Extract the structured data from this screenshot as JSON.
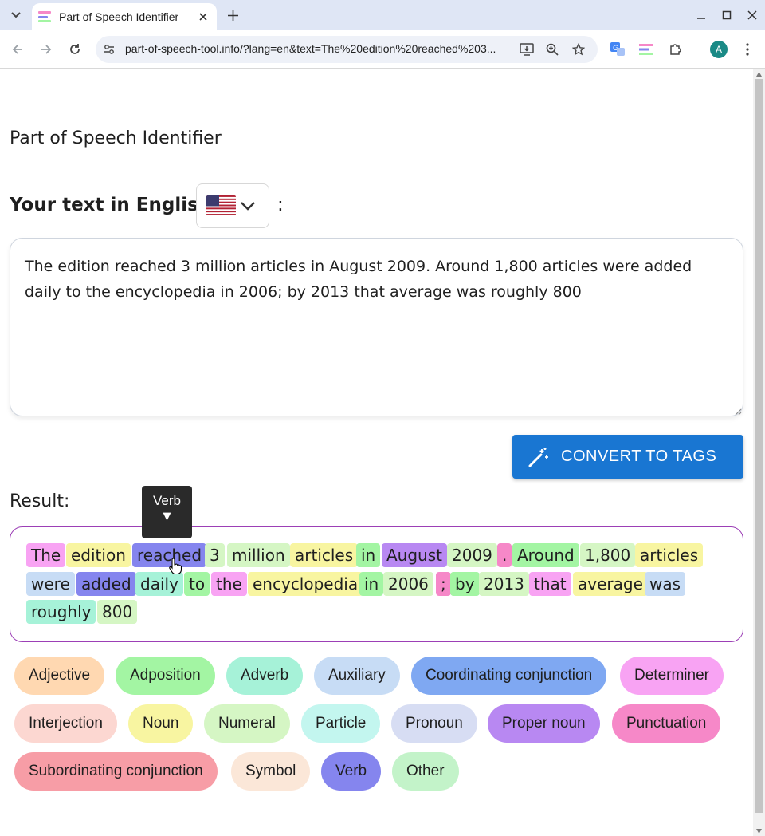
{
  "browser": {
    "tab_title": "Part of Speech Identifier",
    "url": "part-of-speech-tool.info/?lang=en&text=The%20edition%20reached%203...",
    "avatar_letter": "A"
  },
  "page": {
    "title": "Part of Speech Identifier",
    "text_heading": "Your text in English",
    "colon": ":",
    "language_selected": "English (US)",
    "input_text": "The edition reached 3 million articles in August 2009. Around 1,800 articles were added daily to the encyclopedia in 2006; by 2013 that average was roughly 800",
    "convert_button": "CONVERT TO TAGS",
    "result_label": "Result:",
    "tooltip": "Verb",
    "tooltip_arrow": "▼"
  },
  "tokens": [
    {
      "text": "The",
      "pos": "det"
    },
    {
      "text": "edition",
      "pos": "noun"
    },
    {
      "text": "reached",
      "pos": "verb"
    },
    {
      "text": "3",
      "pos": "num"
    },
    {
      "text": "million",
      "pos": "num"
    },
    {
      "text": "articles",
      "pos": "noun"
    },
    {
      "text": "in",
      "pos": "adp"
    },
    {
      "text": "August",
      "pos": "propn"
    },
    {
      "text": "2009",
      "pos": "num"
    },
    {
      "text": ".",
      "pos": "punct"
    },
    {
      "text": "Around",
      "pos": "adp"
    },
    {
      "text": "1,800",
      "pos": "num"
    },
    {
      "text": "articles",
      "pos": "noun"
    },
    {
      "text": "were",
      "pos": "aux"
    },
    {
      "text": "added",
      "pos": "verb"
    },
    {
      "text": "daily",
      "pos": "adv"
    },
    {
      "text": "to",
      "pos": "adp"
    },
    {
      "text": "the",
      "pos": "det"
    },
    {
      "text": "encyclopedia",
      "pos": "noun"
    },
    {
      "text": "in",
      "pos": "adp"
    },
    {
      "text": "2006",
      "pos": "num"
    },
    {
      "text": ";",
      "pos": "punct"
    },
    {
      "text": "by",
      "pos": "adp"
    },
    {
      "text": "2013",
      "pos": "num"
    },
    {
      "text": "that",
      "pos": "det"
    },
    {
      "text": "average",
      "pos": "noun"
    },
    {
      "text": "was",
      "pos": "aux"
    },
    {
      "text": "roughly",
      "pos": "adv"
    },
    {
      "text": "800",
      "pos": "num"
    }
  ],
  "legend": [
    {
      "label": "Adjective",
      "pos": "adj"
    },
    {
      "label": "Adposition",
      "pos": "adp"
    },
    {
      "label": "Adverb",
      "pos": "adv"
    },
    {
      "label": "Auxiliary",
      "pos": "aux"
    },
    {
      "label": "Coordinating conjunction",
      "pos": "cconj"
    },
    {
      "label": "Determiner",
      "pos": "det"
    },
    {
      "label": "Interjection",
      "pos": "intj"
    },
    {
      "label": "Noun",
      "pos": "noun"
    },
    {
      "label": "Numeral",
      "pos": "num"
    },
    {
      "label": "Particle",
      "pos": "part"
    },
    {
      "label": "Pronoun",
      "pos": "pron"
    },
    {
      "label": "Proper noun",
      "pos": "propn"
    },
    {
      "label": "Punctuation",
      "pos": "punct"
    },
    {
      "label": "Subordinating conjunction",
      "pos": "sconj"
    },
    {
      "label": "Symbol",
      "pos": "sym"
    },
    {
      "label": "Verb",
      "pos": "verb"
    },
    {
      "label": "Other",
      "pos": "other"
    }
  ],
  "colors": {
    "adj": "#ffd8b1",
    "adp": "#a3f5a3",
    "adv": "#a6f2d8",
    "aux": "#c7dcf5",
    "cconj": "#7fa8f2",
    "det": "#f8a3f3",
    "intj": "#fcd7d1",
    "noun": "#f8f5a1",
    "num": "#d5f6c4",
    "part": "#c3f6ef",
    "pron": "#d7ddf3",
    "propn": "#b888f2",
    "punct": "#f688c8",
    "sconj": "#f79da6",
    "sym": "#fbe7d8",
    "verb": "#8585ee",
    "other": "#c3f3c9",
    "button": "#1976d2",
    "result_border": "#9c3fb6"
  }
}
